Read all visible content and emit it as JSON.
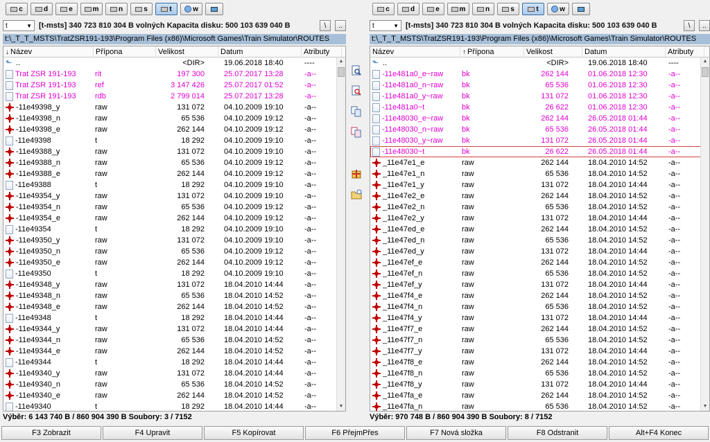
{
  "drive_buttons": [
    "c",
    "d",
    "e",
    "m",
    "n",
    "s",
    "t",
    "w",
    ""
  ],
  "left": {
    "drive": "t",
    "drive_label": "[t-msts]",
    "free_text": "340 723 810 304 B volných",
    "capacity_text": "Kapacita disku: 500 103 639 040 B",
    "root_btn": "\\",
    "up_btn": "..",
    "path": "t:\\_T_T_MSTS\\TratZSR191-193\\Program Files (x86)\\Microsoft Games\\Train Simulator\\ROUTES",
    "headers": {
      "name": "Název",
      "ext": "Přípona",
      "size": "Velikost",
      "date": "Datum",
      "attr": "Atributy"
    },
    "status": "Výběr: 6 143 740 B / 860 904 390 B   Soubory: 3 / 7152",
    "rows": [
      {
        "icon": "up",
        "name": "..",
        "ext": "",
        "size": "<DIR>",
        "date": "19.06.2018 18:40",
        "attr": "----",
        "sel": false
      },
      {
        "icon": "file",
        "name": "Trat ZSR 191-193",
        "ext": "rit",
        "size": "197 300",
        "date": "25.07.2017 13:28",
        "attr": "-a--",
        "sel": true
      },
      {
        "icon": "file",
        "name": "Trat ZSR 191-193",
        "ext": "ref",
        "size": "3 147 426",
        "date": "25.07.2017 01:52",
        "attr": "-a--",
        "sel": true
      },
      {
        "icon": "file",
        "name": "Trat ZSR 191-193",
        "ext": "rdb",
        "size": "2 799 014",
        "date": "25.07.2017 13:28",
        "attr": "-a--",
        "sel": true
      },
      {
        "icon": "red",
        "name": "-11e49398_y",
        "ext": "raw",
        "size": "131 072",
        "date": "04.10.2009 19:10",
        "attr": "-a--",
        "sel": false
      },
      {
        "icon": "red",
        "name": "-11e49398_n",
        "ext": "raw",
        "size": "65 536",
        "date": "04.10.2009 19:12",
        "attr": "-a--",
        "sel": false
      },
      {
        "icon": "red",
        "name": "-11e49398_e",
        "ext": "raw",
        "size": "262 144",
        "date": "04.10.2009 19:12",
        "attr": "-a--",
        "sel": false
      },
      {
        "icon": "file",
        "name": "-11e49398",
        "ext": "t",
        "size": "18 292",
        "date": "04.10.2009 19:10",
        "attr": "-a--",
        "sel": false
      },
      {
        "icon": "red",
        "name": "-11e49388_y",
        "ext": "raw",
        "size": "131 072",
        "date": "04.10.2009 19:10",
        "attr": "-a--",
        "sel": false
      },
      {
        "icon": "red",
        "name": "-11e49388_n",
        "ext": "raw",
        "size": "65 536",
        "date": "04.10.2009 19:12",
        "attr": "-a--",
        "sel": false
      },
      {
        "icon": "red",
        "name": "-11e49388_e",
        "ext": "raw",
        "size": "262 144",
        "date": "04.10.2009 19:12",
        "attr": "-a--",
        "sel": false
      },
      {
        "icon": "file",
        "name": "-11e49388",
        "ext": "t",
        "size": "18 292",
        "date": "04.10.2009 19:10",
        "attr": "-a--",
        "sel": false
      },
      {
        "icon": "red",
        "name": "-11e49354_y",
        "ext": "raw",
        "size": "131 072",
        "date": "04.10.2009 19:10",
        "attr": "-a--",
        "sel": false
      },
      {
        "icon": "red",
        "name": "-11e49354_n",
        "ext": "raw",
        "size": "65 536",
        "date": "04.10.2009 19:12",
        "attr": "-a--",
        "sel": false
      },
      {
        "icon": "red",
        "name": "-11e49354_e",
        "ext": "raw",
        "size": "262 144",
        "date": "04.10.2009 19:12",
        "attr": "-a--",
        "sel": false
      },
      {
        "icon": "file",
        "name": "-11e49354",
        "ext": "t",
        "size": "18 292",
        "date": "04.10.2009 19:10",
        "attr": "-a--",
        "sel": false
      },
      {
        "icon": "red",
        "name": "-11e49350_y",
        "ext": "raw",
        "size": "131 072",
        "date": "04.10.2009 19:10",
        "attr": "-a--",
        "sel": false
      },
      {
        "icon": "red",
        "name": "-11e49350_n",
        "ext": "raw",
        "size": "65 536",
        "date": "04.10.2009 19:12",
        "attr": "-a--",
        "sel": false
      },
      {
        "icon": "red",
        "name": "-11e49350_e",
        "ext": "raw",
        "size": "262 144",
        "date": "04.10.2009 19:12",
        "attr": "-a--",
        "sel": false
      },
      {
        "icon": "file",
        "name": "-11e49350",
        "ext": "t",
        "size": "18 292",
        "date": "04.10.2009 19:10",
        "attr": "-a--",
        "sel": false
      },
      {
        "icon": "red",
        "name": "-11e49348_y",
        "ext": "raw",
        "size": "131 072",
        "date": "18.04.2010 14:44",
        "attr": "-a--",
        "sel": false
      },
      {
        "icon": "red",
        "name": "-11e49348_n",
        "ext": "raw",
        "size": "65 536",
        "date": "18.04.2010 14:52",
        "attr": "-a--",
        "sel": false
      },
      {
        "icon": "red",
        "name": "-11e49348_e",
        "ext": "raw",
        "size": "262 144",
        "date": "18.04.2010 14:52",
        "attr": "-a--",
        "sel": false
      },
      {
        "icon": "file",
        "name": "-11e49348",
        "ext": "t",
        "size": "18 292",
        "date": "18.04.2010 14:44",
        "attr": "-a--",
        "sel": false
      },
      {
        "icon": "red",
        "name": "-11e49344_y",
        "ext": "raw",
        "size": "131 072",
        "date": "18.04.2010 14:44",
        "attr": "-a--",
        "sel": false
      },
      {
        "icon": "red",
        "name": "-11e49344_n",
        "ext": "raw",
        "size": "65 536",
        "date": "18.04.2010 14:52",
        "attr": "-a--",
        "sel": false
      },
      {
        "icon": "red",
        "name": "-11e49344_e",
        "ext": "raw",
        "size": "262 144",
        "date": "18.04.2010 14:52",
        "attr": "-a--",
        "sel": false
      },
      {
        "icon": "file",
        "name": "-11e49344",
        "ext": "t",
        "size": "18 292",
        "date": "18.04.2010 14:44",
        "attr": "-a--",
        "sel": false
      },
      {
        "icon": "red",
        "name": "-11e49340_y",
        "ext": "raw",
        "size": "131 072",
        "date": "18.04.2010 14:44",
        "attr": "-a--",
        "sel": false
      },
      {
        "icon": "red",
        "name": "-11e49340_n",
        "ext": "raw",
        "size": "65 536",
        "date": "18.04.2010 14:52",
        "attr": "-a--",
        "sel": false
      },
      {
        "icon": "red",
        "name": "-11e49340_e",
        "ext": "raw",
        "size": "262 144",
        "date": "18.04.2010 14:52",
        "attr": "-a--",
        "sel": false
      },
      {
        "icon": "file",
        "name": "-11e49340",
        "ext": "t",
        "size": "18 292",
        "date": "18.04.2010 14:44",
        "attr": "-a--",
        "sel": false
      }
    ]
  },
  "right": {
    "drive": "t",
    "drive_label": "[t-msts]",
    "free_text": "340 723 810 304 B volných",
    "capacity_text": "Kapacita disku: 500 103 639 040 B",
    "root_btn": "\\",
    "up_btn": "..",
    "path": "t:\\_T_T_MSTS\\TratZSR191-193\\Program Files (x86)\\Microsoft Games\\Train Simulator\\ROUTES",
    "headers": {
      "name": "Název",
      "ext": "Přípona",
      "size": "Velikost",
      "date": "Datum",
      "attr": "Atributy"
    },
    "status": "Výběr: 970 748 B / 860 904 390 B   Soubory: 8 / 7152",
    "rows": [
      {
        "icon": "up",
        "name": "..",
        "ext": "",
        "size": "<DIR>",
        "date": "19.06.2018 18:40",
        "attr": "----",
        "sel": false
      },
      {
        "icon": "file",
        "name": "-11e481a0_e~raw",
        "ext": "bk",
        "size": "262 144",
        "date": "01.06.2018 12:30",
        "attr": "-a--",
        "sel": true
      },
      {
        "icon": "file",
        "name": "-11e481a0_n~raw",
        "ext": "bk",
        "size": "65 536",
        "date": "01.06.2018 12:30",
        "attr": "-a--",
        "sel": true
      },
      {
        "icon": "file",
        "name": "-11e481a0_y~raw",
        "ext": "bk",
        "size": "131 072",
        "date": "01.06.2018 12:30",
        "attr": "-a--",
        "sel": true
      },
      {
        "icon": "file",
        "name": "-11e481a0~t",
        "ext": "bk",
        "size": "26 622",
        "date": "01.06.2018 12:30",
        "attr": "-a--",
        "sel": true
      },
      {
        "icon": "file",
        "name": "-11e48030_e~raw",
        "ext": "bk",
        "size": "262 144",
        "date": "26.05.2018 01:44",
        "attr": "-a--",
        "sel": true
      },
      {
        "icon": "file",
        "name": "-11e48030_n~raw",
        "ext": "bk",
        "size": "65 536",
        "date": "26.05.2018 01:44",
        "attr": "-a--",
        "sel": true
      },
      {
        "icon": "file",
        "name": "-11e48030_y~raw",
        "ext": "bk",
        "size": "131 072",
        "date": "26.05.2018 01:44",
        "attr": "-a--",
        "sel": true
      },
      {
        "icon": "file",
        "name": "-11e48030~t",
        "ext": "bk",
        "size": "26 622",
        "date": "26.05.2018 01:44",
        "attr": "-a--",
        "sel": true,
        "cursor": true
      },
      {
        "icon": "red",
        "name": "_11e47e1_e",
        "ext": "raw",
        "size": "262 144",
        "date": "18.04.2010 14:52",
        "attr": "-a--",
        "sel": false
      },
      {
        "icon": "red",
        "name": "_11e47e1_n",
        "ext": "raw",
        "size": "65 536",
        "date": "18.04.2010 14:52",
        "attr": "-a--",
        "sel": false
      },
      {
        "icon": "red",
        "name": "_11e47e1_y",
        "ext": "raw",
        "size": "131 072",
        "date": "18.04.2010 14:44",
        "attr": "-a--",
        "sel": false
      },
      {
        "icon": "red",
        "name": "_11e47e2_e",
        "ext": "raw",
        "size": "262 144",
        "date": "18.04.2010 14:52",
        "attr": "-a--",
        "sel": false
      },
      {
        "icon": "red",
        "name": "_11e47e2_n",
        "ext": "raw",
        "size": "65 536",
        "date": "18.04.2010 14:52",
        "attr": "-a--",
        "sel": false
      },
      {
        "icon": "red",
        "name": "_11e47e2_y",
        "ext": "raw",
        "size": "131 072",
        "date": "18.04.2010 14:44",
        "attr": "-a--",
        "sel": false
      },
      {
        "icon": "red",
        "name": "_11e47ed_e",
        "ext": "raw",
        "size": "262 144",
        "date": "18.04.2010 14:52",
        "attr": "-a--",
        "sel": false
      },
      {
        "icon": "red",
        "name": "_11e47ed_n",
        "ext": "raw",
        "size": "65 536",
        "date": "18.04.2010 14:52",
        "attr": "-a--",
        "sel": false
      },
      {
        "icon": "red",
        "name": "_11e47ed_y",
        "ext": "raw",
        "size": "131 072",
        "date": "18.04.2010 14:44",
        "attr": "-a--",
        "sel": false
      },
      {
        "icon": "red",
        "name": "_11e47ef_e",
        "ext": "raw",
        "size": "262 144",
        "date": "18.04.2010 14:52",
        "attr": "-a--",
        "sel": false
      },
      {
        "icon": "red",
        "name": "_11e47ef_n",
        "ext": "raw",
        "size": "65 536",
        "date": "18.04.2010 14:52",
        "attr": "-a--",
        "sel": false
      },
      {
        "icon": "red",
        "name": "_11e47ef_y",
        "ext": "raw",
        "size": "131 072",
        "date": "18.04.2010 14:44",
        "attr": "-a--",
        "sel": false
      },
      {
        "icon": "red",
        "name": "_11e47f4_e",
        "ext": "raw",
        "size": "262 144",
        "date": "18.04.2010 14:52",
        "attr": "-a--",
        "sel": false
      },
      {
        "icon": "red",
        "name": "_11e47f4_n",
        "ext": "raw",
        "size": "65 536",
        "date": "18.04.2010 14:52",
        "attr": "-a--",
        "sel": false
      },
      {
        "icon": "red",
        "name": "_11e47f4_y",
        "ext": "raw",
        "size": "131 072",
        "date": "18.04.2010 14:44",
        "attr": "-a--",
        "sel": false
      },
      {
        "icon": "red",
        "name": "_11e47f7_e",
        "ext": "raw",
        "size": "262 144",
        "date": "18.04.2010 14:52",
        "attr": "-a--",
        "sel": false
      },
      {
        "icon": "red",
        "name": "_11e47f7_n",
        "ext": "raw",
        "size": "65 536",
        "date": "18.04.2010 14:52",
        "attr": "-a--",
        "sel": false
      },
      {
        "icon": "red",
        "name": "_11e47f7_y",
        "ext": "raw",
        "size": "131 072",
        "date": "18.04.2010 14:44",
        "attr": "-a--",
        "sel": false
      },
      {
        "icon": "red",
        "name": "_11e47f8_e",
        "ext": "raw",
        "size": "262 144",
        "date": "18.04.2010 14:52",
        "attr": "-a--",
        "sel": false
      },
      {
        "icon": "red",
        "name": "_11e47f8_n",
        "ext": "raw",
        "size": "65 536",
        "date": "18.04.2010 14:52",
        "attr": "-a--",
        "sel": false
      },
      {
        "icon": "red",
        "name": "_11e47f8_y",
        "ext": "raw",
        "size": "131 072",
        "date": "18.04.2010 14:44",
        "attr": "-a--",
        "sel": false
      },
      {
        "icon": "red",
        "name": "_11e47fa_e",
        "ext": "raw",
        "size": "262 144",
        "date": "18.04.2010 14:52",
        "attr": "-a--",
        "sel": false
      },
      {
        "icon": "red",
        "name": "_11e47fa_n",
        "ext": "raw",
        "size": "65 536",
        "date": "18.04.2010 14:52",
        "attr": "-a--",
        "sel": false
      }
    ]
  },
  "middle_tools": [
    "find-icon",
    "find-files-icon",
    "copy-names-icon",
    "compare-icon",
    "pack-icon",
    "new-folder-icon"
  ],
  "function_keys": [
    "F3 Zobrazit",
    "F4 Upravit",
    "F5 Kopírovat",
    "F6 PřejmPřes",
    "F7 Nová složka",
    "F8 Odstranit",
    "Alt+F4 Konec"
  ],
  "colors": {
    "selected_text": "#e000d0",
    "path_bar": "#a7bfd8",
    "cursor_outline": "#d04040"
  }
}
